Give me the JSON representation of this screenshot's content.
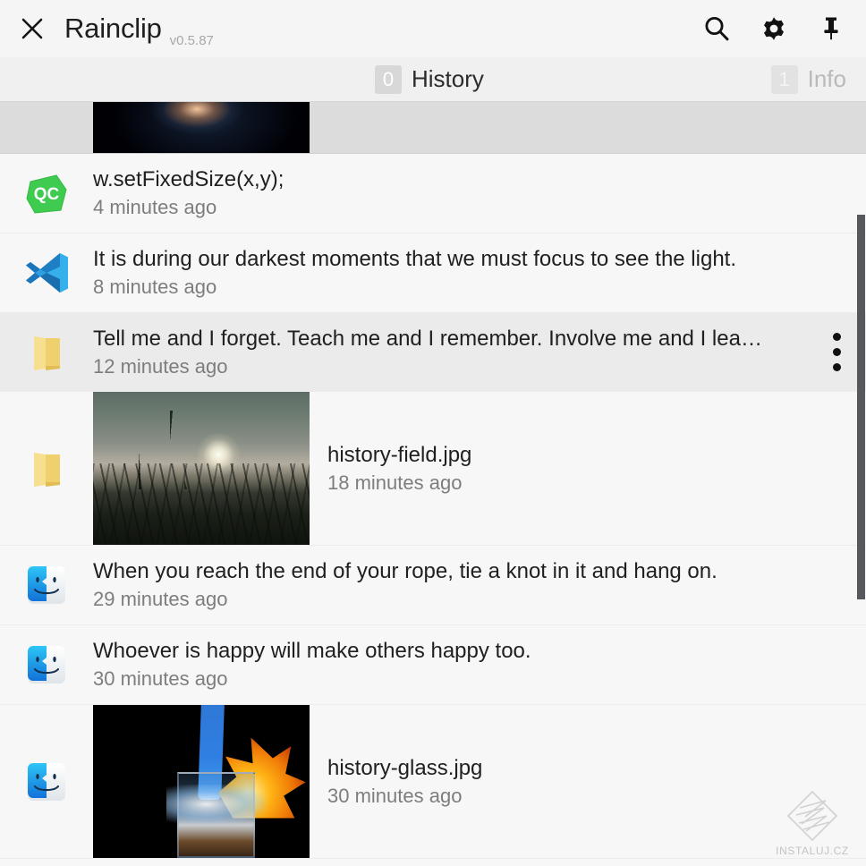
{
  "window": {
    "app_title": "Rainclip",
    "version": "v0.5.87",
    "close_label": "✕"
  },
  "titlebar": {
    "icons": [
      {
        "name": "search-icon",
        "label": "Search"
      },
      {
        "name": "gear-icon",
        "label": "Settings"
      },
      {
        "name": "pin-icon",
        "label": "Pin"
      }
    ]
  },
  "tabs": [
    {
      "badge": "0",
      "label": "History",
      "active": true
    },
    {
      "badge": "1",
      "label": "Info",
      "active": false
    }
  ],
  "history": {
    "items": [
      {
        "icon": "image-thumbnail",
        "title": "",
        "time": "",
        "thumb": "night",
        "state": "scrolled-top",
        "has_menu": false
      },
      {
        "icon": "qt-creator-icon",
        "icon_text": "QC",
        "title": "w.setFixedSize(x,y);",
        "time": "4 minutes ago",
        "state": "normal",
        "has_menu": false
      },
      {
        "icon": "vscode-icon",
        "title": "It is during our darkest moments that we must focus to see the light.",
        "time": "8 minutes ago",
        "state": "normal",
        "has_menu": false
      },
      {
        "icon": "folder-icon",
        "title": "Tell me and I forget. Teach me and I remember. Involve me and I lea…",
        "time": "12 minutes ago",
        "state": "selected",
        "has_menu": true
      },
      {
        "icon": "folder-icon",
        "title": "history-field.jpg",
        "time": "18 minutes ago",
        "thumb": "field",
        "state": "normal",
        "has_menu": false
      },
      {
        "icon": "finder-icon",
        "title": "When you reach the end of your rope, tie a knot in it and hang on.",
        "time": "29 minutes ago",
        "state": "normal",
        "has_menu": false
      },
      {
        "icon": "finder-icon",
        "title": "Whoever is happy will make others happy too.",
        "time": "30 minutes ago",
        "state": "normal",
        "has_menu": false
      },
      {
        "icon": "finder-icon",
        "title": "history-glass.jpg",
        "time": "30 minutes ago",
        "thumb": "glass",
        "state": "normal",
        "has_menu": false
      }
    ]
  },
  "watermark": {
    "text": "INSTALUJ.CZ"
  },
  "colors": {
    "titlebar_bg": "#f5f5f5",
    "tabbar_bg": "#f0f0f0",
    "list_bg": "#f7f7f7",
    "row_selected_bg": "#ebebeb",
    "row_scrolled_bg": "#dcdcdc",
    "title_text": "#1f1f1f",
    "time_text": "#7d7d7d",
    "tab_inactive": "#b9b9b9",
    "scrollbar_thumb": "#55595e",
    "folder_yellow": "#f2d37a",
    "qt_green": "#41cd52",
    "vscode_blue": "#2490d4",
    "finder_blue": "#1e9bf0"
  }
}
